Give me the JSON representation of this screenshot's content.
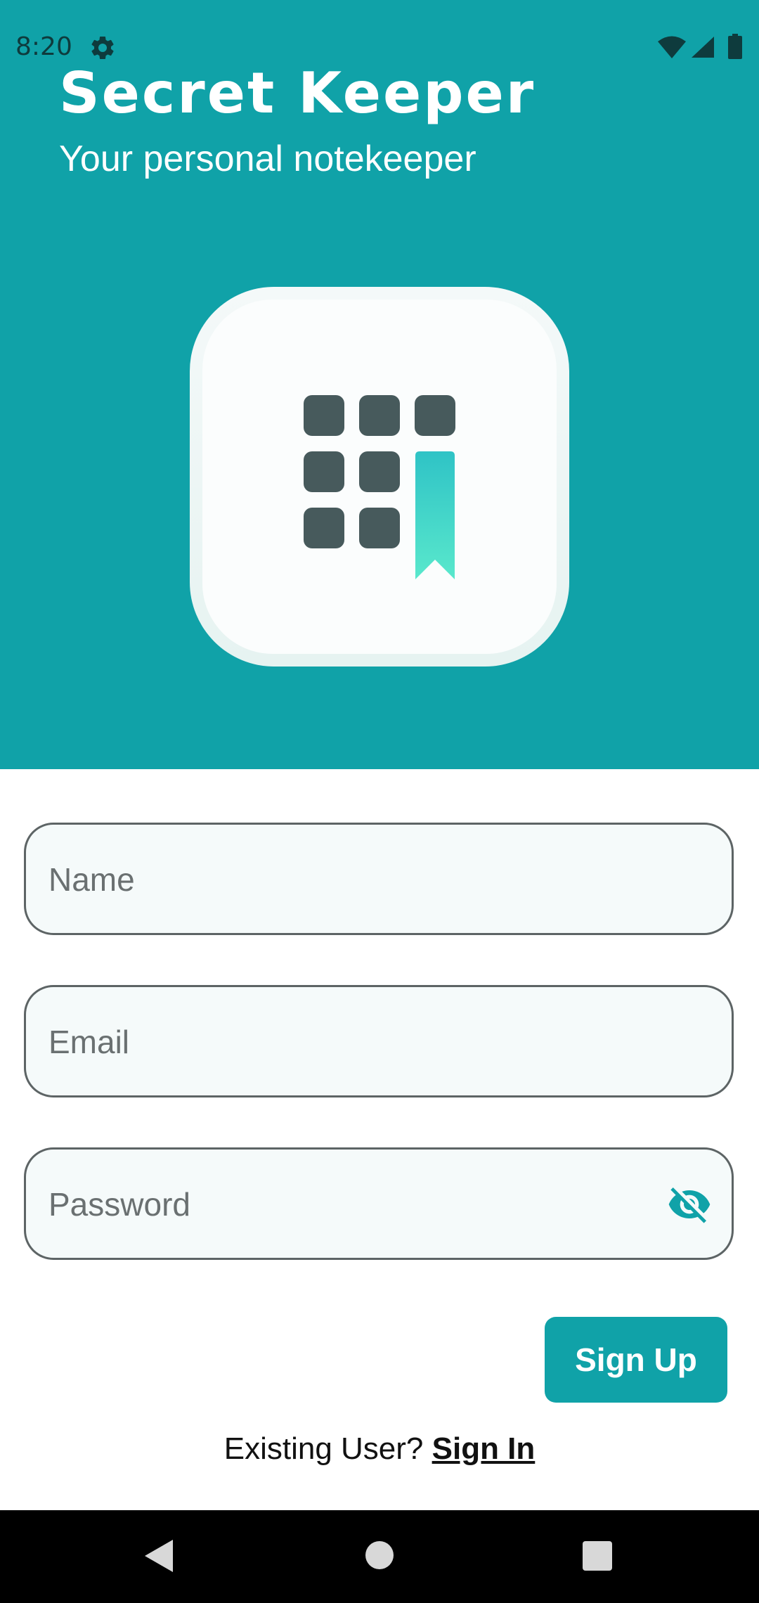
{
  "status_bar": {
    "time": "8:20",
    "icons": [
      "gear-icon",
      "wifi-icon",
      "signal-icon",
      "battery-icon"
    ]
  },
  "header": {
    "title": "Secret Keeper",
    "subtitle": "Your personal notekeeper",
    "logo": "app-logo-grid-bookmark"
  },
  "form": {
    "name": {
      "placeholder": "Name",
      "value": ""
    },
    "email": {
      "placeholder": "Email",
      "value": ""
    },
    "password": {
      "placeholder": "Password",
      "value": "",
      "toggle_icon": "visibility-off-icon"
    },
    "submit_label": "Sign Up"
  },
  "footer": {
    "prompt": "Existing User?",
    "link_label": "Sign In"
  },
  "nav_bar": {
    "icons": [
      "back-icon",
      "home-icon",
      "recents-icon"
    ]
  },
  "colors": {
    "accent": "#10a2a8",
    "field_background": "#f5fafa",
    "field_border": "#5d6465",
    "nav_bar": "#000000"
  }
}
